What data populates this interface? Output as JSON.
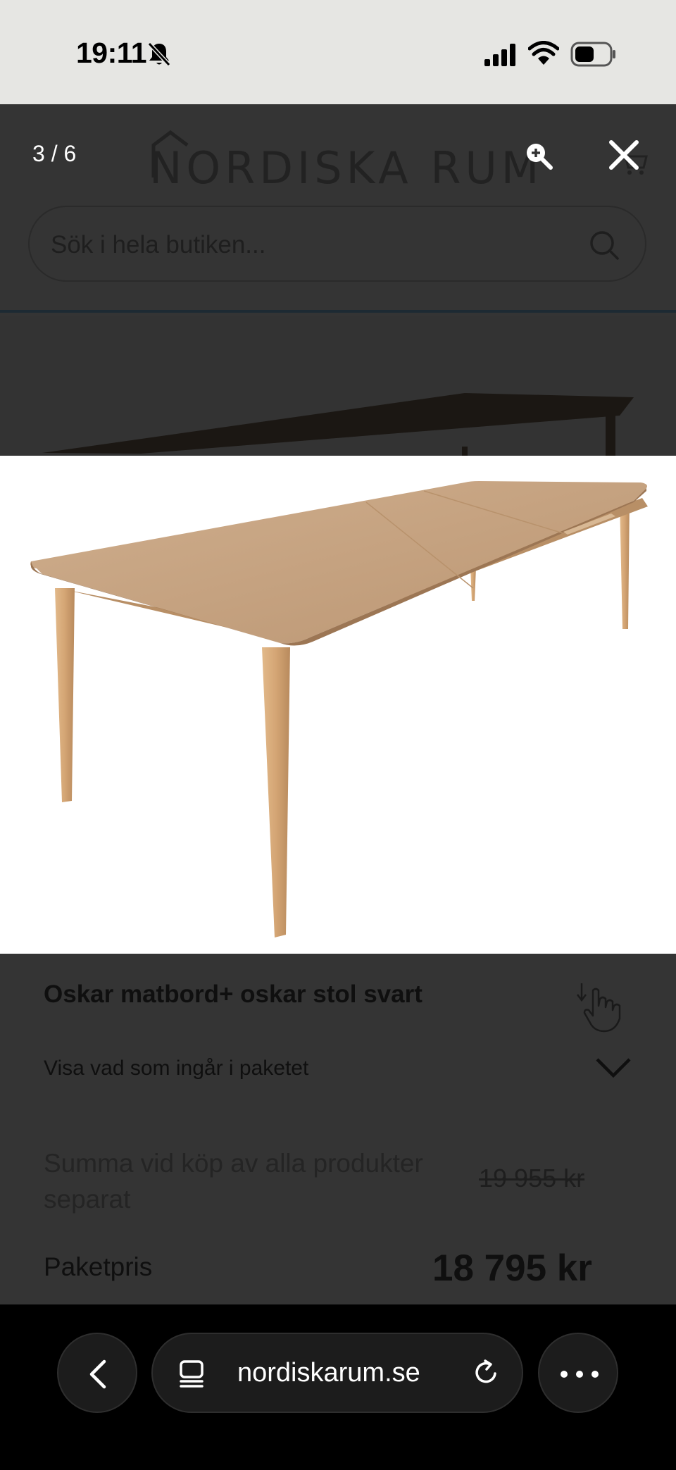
{
  "status_bar": {
    "time": "19:11",
    "icons": [
      "bell-slash-icon",
      "signal-icon",
      "wifi-icon",
      "battery-icon"
    ]
  },
  "site": {
    "logo_text": "NORDISKA RUM",
    "search_placeholder": "Sök i hela butiken...",
    "icons": [
      "cart-icon",
      "search-icon"
    ]
  },
  "gallery": {
    "counter": "3 / 6",
    "icons": [
      "zoom-in-icon",
      "close-icon"
    ]
  },
  "product": {
    "title": "Oskar matbord+ oskar stol svart",
    "package_toggle_label": "Visa vad som ingår i paketet",
    "sum_label": "Summa vid köp av alla produkter separat",
    "old_price": "19 955 kr",
    "package_price_label": "Paketpris",
    "package_price": "18 795 kr"
  },
  "browser": {
    "url": "nordiskarum.se",
    "icons": [
      "back-icon",
      "tabs-icon",
      "reload-icon",
      "more-icon"
    ]
  },
  "colors": {
    "overlay_bg": "#333333",
    "browser_bar": "#000000",
    "status_bar": "#e6e6e3",
    "wood": "#c9a27a"
  }
}
